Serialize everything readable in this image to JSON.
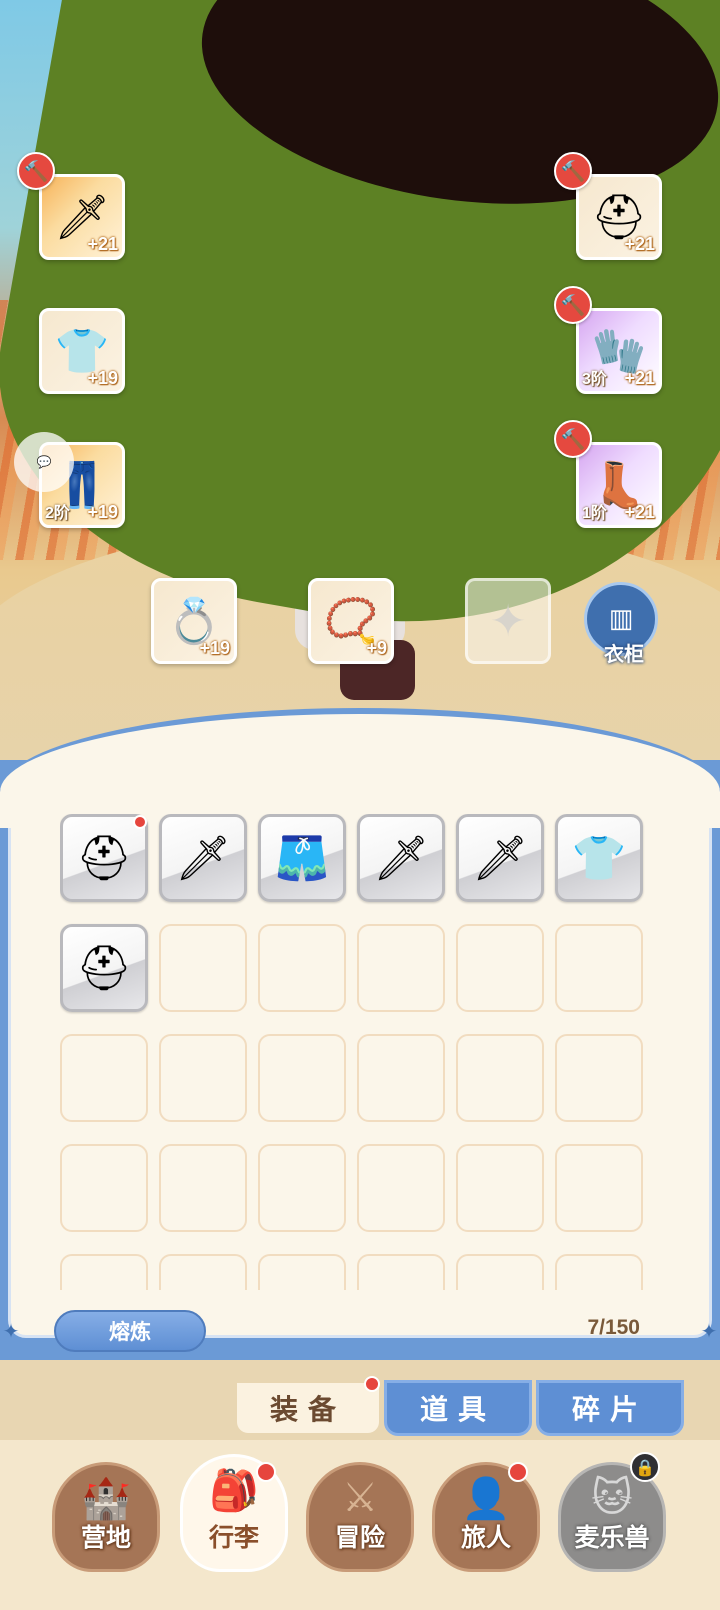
{
  "equipment": {
    "weapon": {
      "level": "+21",
      "icon": "sword-icon"
    },
    "armor": {
      "level": "+19",
      "icon": "tunic-icon"
    },
    "pants": {
      "level": "+19",
      "tier": "2阶",
      "icon": "pants-icon"
    },
    "helmet": {
      "level": "+21",
      "icon": "helmet-icon"
    },
    "gloves": {
      "level": "+21",
      "tier": "3阶",
      "icon": "gauntlet-icon"
    },
    "boots": {
      "level": "+21",
      "tier": "1阶",
      "icon": "boots-icon"
    },
    "ring": {
      "level": "+19",
      "icon": "ring-icon"
    },
    "necklace": {
      "level": "+9",
      "icon": "necklace-icon"
    },
    "charm": {
      "icon": "charm-bag-icon"
    }
  },
  "wardrobe": {
    "label": "衣柜"
  },
  "inventory": {
    "items": [
      {
        "icon": "helmet-icon",
        "new": true
      },
      {
        "icon": "sword-icon",
        "new": false
      },
      {
        "icon": "skirt-icon",
        "new": false
      },
      {
        "icon": "sword-icon",
        "new": false
      },
      {
        "icon": "sword-icon",
        "new": false
      },
      {
        "icon": "tunic-icon",
        "new": false
      },
      {
        "icon": "helmet-icon",
        "new": false
      }
    ],
    "smelt_label": "熔炼",
    "capacity": "7/150"
  },
  "tabs": [
    {
      "label": "装备",
      "active": true,
      "badge": true
    },
    {
      "label": "道具",
      "active": false,
      "badge": false
    },
    {
      "label": "碎片",
      "active": false,
      "badge": false
    }
  ],
  "nav": [
    {
      "label": "营地",
      "icon": "castle-icon",
      "active": false,
      "badge": false,
      "locked": false
    },
    {
      "label": "行李",
      "icon": "backpack-icon",
      "active": true,
      "badge": true,
      "locked": false
    },
    {
      "label": "冒险",
      "icon": "crossed-swords-icon",
      "active": false,
      "badge": false,
      "locked": false
    },
    {
      "label": "旅人",
      "icon": "traveler-icon",
      "active": false,
      "badge": true,
      "locked": false
    },
    {
      "label": "麦乐兽",
      "icon": "cat-icon",
      "active": false,
      "badge": false,
      "locked": true
    }
  ],
  "colors": {
    "panel_blue": "#6b9ad6",
    "badge_red": "#e6453d",
    "panel_bg": "#fbf6ea"
  }
}
